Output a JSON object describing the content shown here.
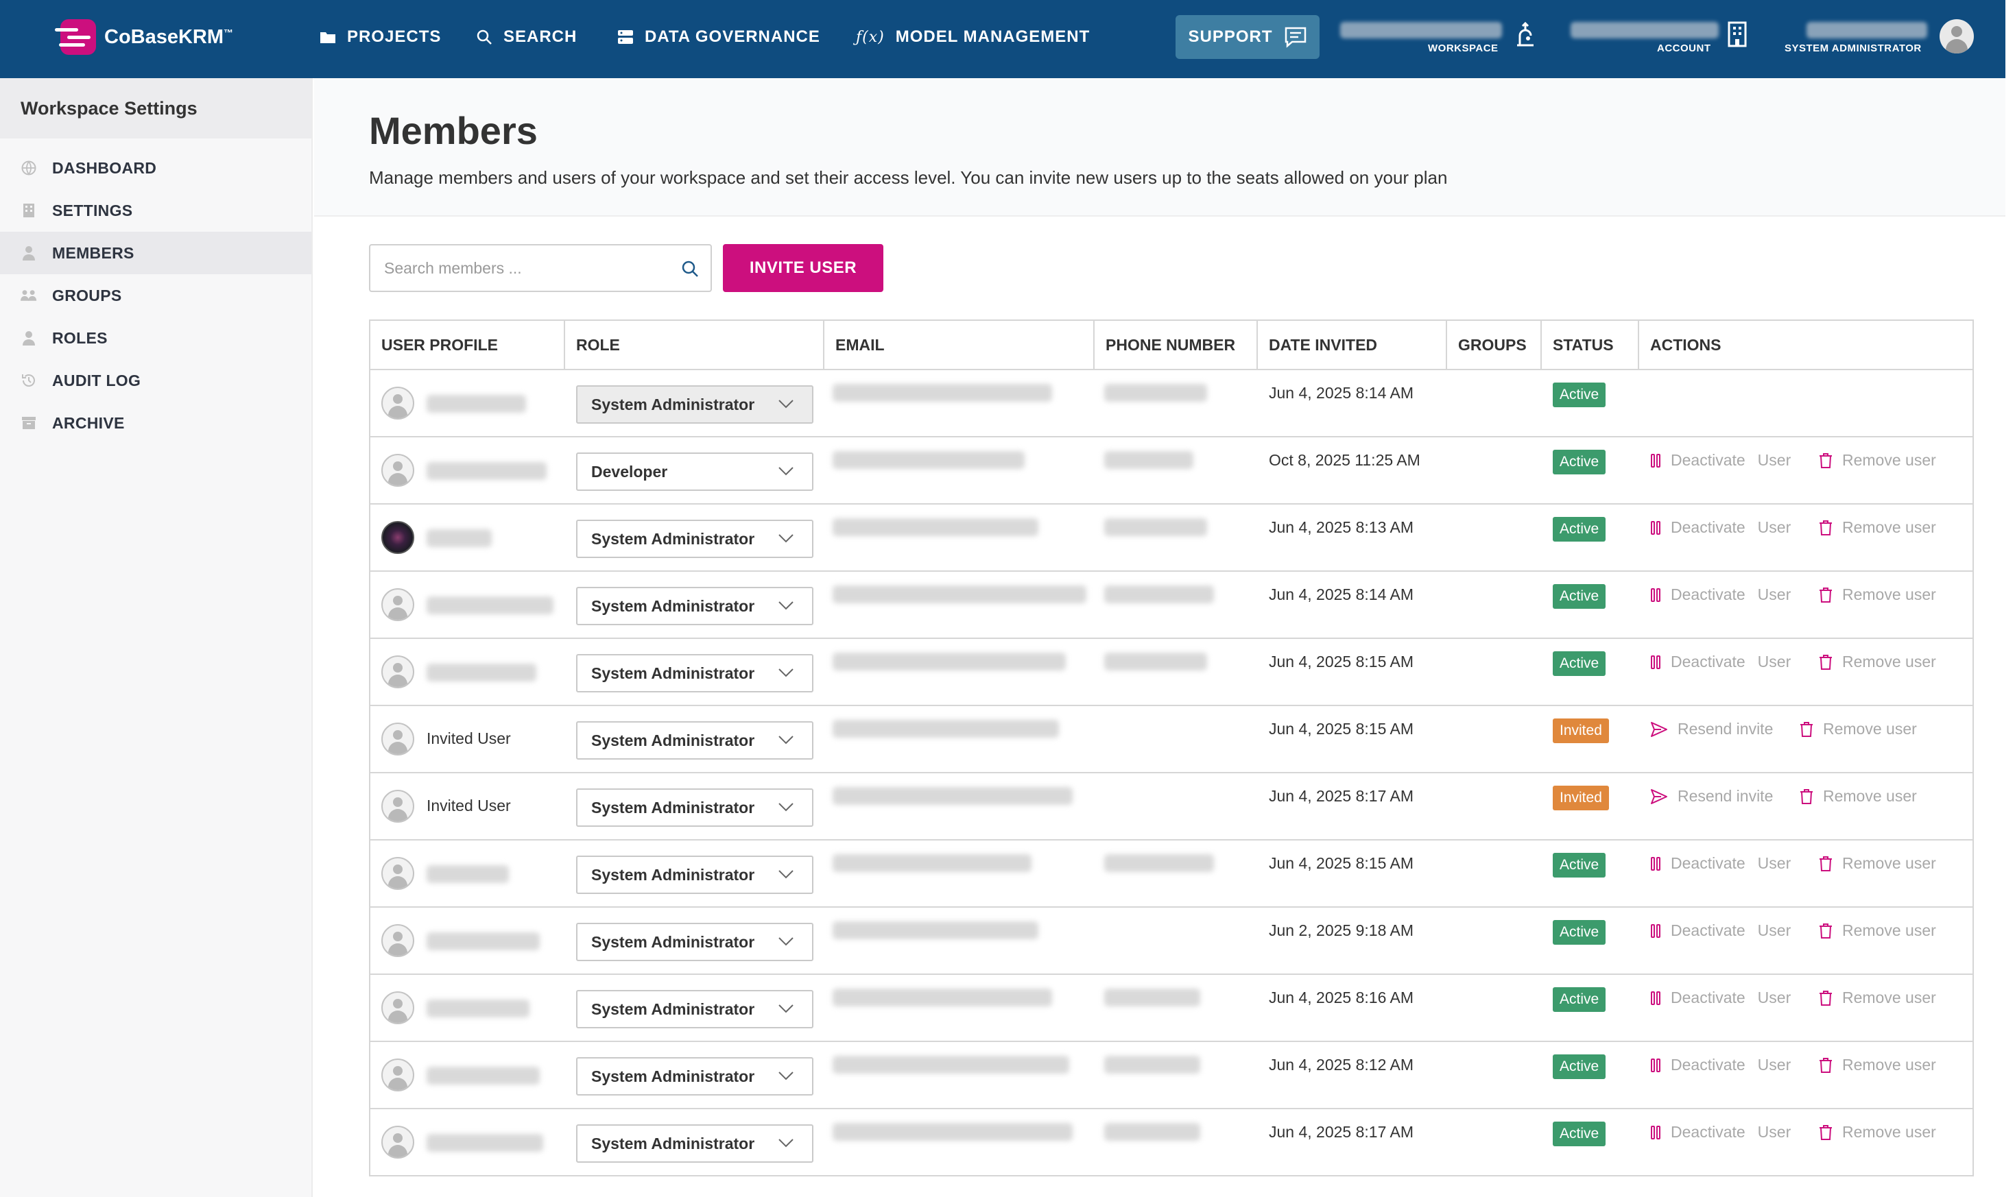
{
  "brand": {
    "name": "CoBaseKRM",
    "tm": "™",
    "accent": "#cc0f7e",
    "topbar_color": "#0f4c7f"
  },
  "nav": [
    {
      "label": "PROJECTS",
      "icon": "folder-icon"
    },
    {
      "label": "SEARCH",
      "icon": "search-icon"
    },
    {
      "label": "DATA GOVERNANCE",
      "icon": "database-icon"
    },
    {
      "label": "MODEL MANAGEMENT",
      "icon": "function-icon"
    }
  ],
  "topbar": {
    "support_label": "SUPPORT",
    "workspace_caption": "WORKSPACE",
    "account_caption": "ACCOUNT",
    "user_caption": "SYSTEM ADMINISTRATOR"
  },
  "sidebar": {
    "title": "Workspace Settings",
    "items": [
      {
        "label": "DASHBOARD",
        "icon": "globe-icon"
      },
      {
        "label": "SETTINGS",
        "icon": "building-icon"
      },
      {
        "label": "MEMBERS",
        "icon": "person-icon",
        "active": true
      },
      {
        "label": "GROUPS",
        "icon": "people-icon"
      },
      {
        "label": "ROLES",
        "icon": "person-badge-icon"
      },
      {
        "label": "AUDIT LOG",
        "icon": "history-icon"
      },
      {
        "label": "ARCHIVE",
        "icon": "archive-icon"
      }
    ]
  },
  "page": {
    "title": "Members",
    "description": "Manage members and users of your workspace and set their access level. You can invite new users up to the seats allowed on your plan",
    "search_placeholder": "Search members ...",
    "invite_label": "INVITE USER"
  },
  "table": {
    "columns": [
      "USER PROFILE",
      "ROLE",
      "EMAIL",
      "PHONE NUMBER",
      "DATE INVITED",
      "GROUPS",
      "STATUS",
      "ACTIONS"
    ],
    "action_labels": {
      "deactivate": "Deactivate",
      "user": "User",
      "remove": "Remove user",
      "resend": "Resend invite"
    },
    "rows": [
      {
        "name": "",
        "role": "System Administrator",
        "date": "Jun 4, 2025 8:14 AM",
        "status": "Active",
        "actions": "none"
      },
      {
        "name": "",
        "role": "Developer",
        "date": "Oct 8, 2025 11:25 AM",
        "status": "Active",
        "actions": "active"
      },
      {
        "name": "",
        "role": "System Administrator",
        "date": "Jun 4, 2025 8:13 AM",
        "status": "Active",
        "actions": "active",
        "photo": true
      },
      {
        "name": "",
        "role": "System Administrator",
        "date": "Jun 4, 2025 8:14 AM",
        "status": "Active",
        "actions": "active"
      },
      {
        "name": "",
        "role": "System Administrator",
        "date": "Jun 4, 2025 8:15 AM",
        "status": "Active",
        "actions": "active"
      },
      {
        "name": "Invited User",
        "role": "System Administrator",
        "date": "Jun 4, 2025 8:15 AM",
        "status": "Invited",
        "actions": "invited"
      },
      {
        "name": "Invited User",
        "role": "System Administrator",
        "date": "Jun 4, 2025 8:17 AM",
        "status": "Invited",
        "actions": "invited"
      },
      {
        "name": "",
        "role": "System Administrator",
        "date": "Jun 4, 2025 8:15 AM",
        "status": "Active",
        "actions": "active"
      },
      {
        "name": "",
        "role": "System Administrator",
        "date": "Jun 2, 2025 9:18 AM",
        "status": "Active",
        "actions": "active"
      },
      {
        "name": "",
        "role": "System Administrator",
        "date": "Jun 4, 2025 8:16 AM",
        "status": "Active",
        "actions": "active"
      },
      {
        "name": "",
        "role": "System Administrator",
        "date": "Jun 4, 2025 8:12 AM",
        "status": "Active",
        "actions": "active"
      },
      {
        "name": "",
        "role": "System Administrator",
        "date": "Jun 4, 2025 8:17 AM",
        "status": "Active",
        "actions": "active"
      }
    ]
  }
}
